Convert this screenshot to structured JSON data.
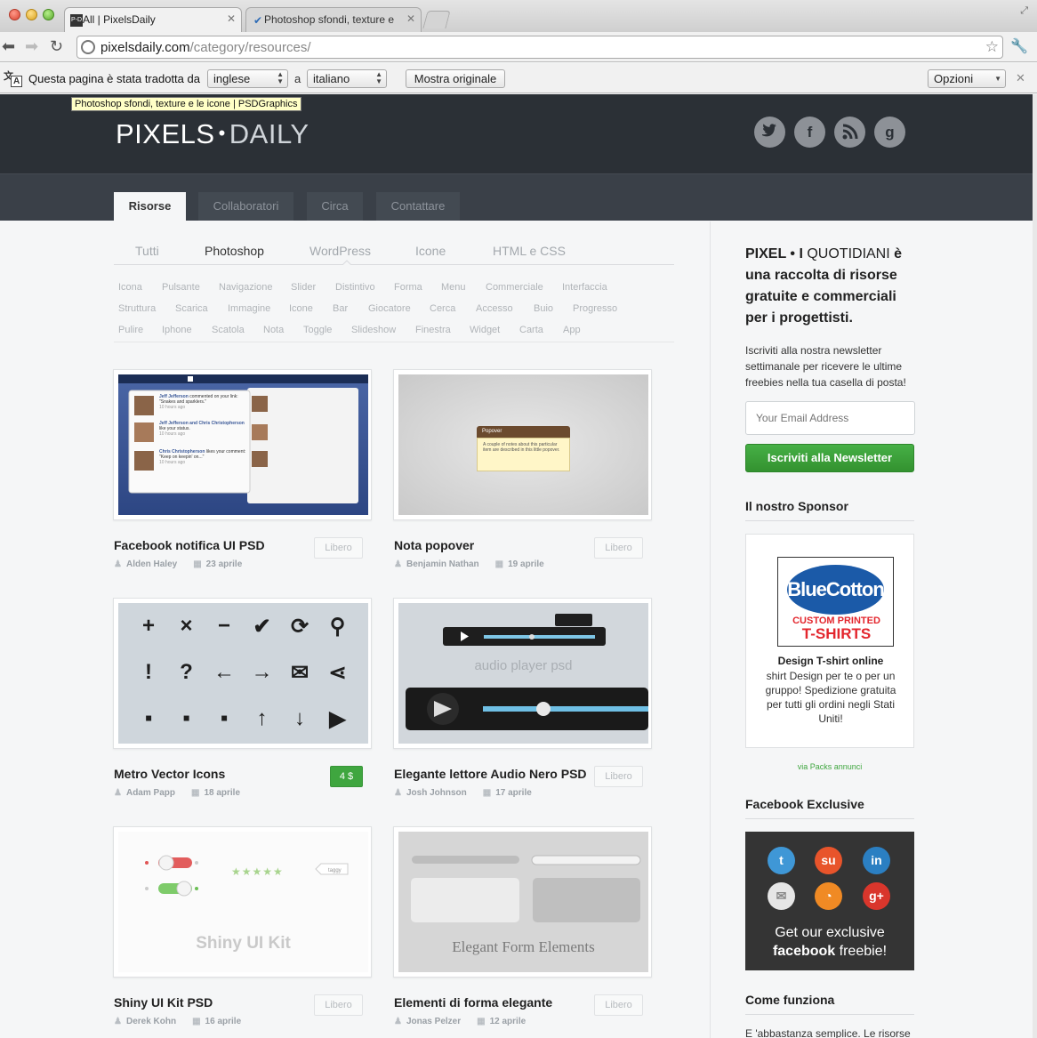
{
  "browser": {
    "tabs": [
      {
        "label": "All | PixelsDaily",
        "favicon": "P-D"
      },
      {
        "label": "Photoshop sfondi, texture e",
        "favicon": "✔"
      }
    ],
    "url_domain": "pixelsdaily.com",
    "url_path": "/category/resources/",
    "translate_bar": {
      "message": "Questa pagina è stata tradotta da",
      "from": "inglese",
      "to_word": "a",
      "to": "italiano",
      "show_original": "Mostra originale",
      "options": "Opzioni"
    },
    "tooltip": "Photoshop sfondi, texture e le icone | PSDGraphics"
  },
  "site": {
    "logo_pixels": "PIXELS",
    "logo_dot": "•",
    "logo_daily": "DAILY",
    "nav": [
      "Risorse",
      "Collaboratori",
      "Circa",
      "Contattare"
    ],
    "filters": [
      "Tutti",
      "Photoshop",
      "WordPress",
      "Icone",
      "HTML e CSS"
    ],
    "tags": [
      [
        "Icona",
        "Pulsante",
        "Navigazione",
        "Slider",
        "Distintivo",
        "Forma",
        "Menu",
        "Commerciale",
        "Interfaccia"
      ],
      [
        "Struttura",
        "Scarica",
        "Immagine",
        "Icone",
        "Bar",
        "Giocatore",
        "Cerca",
        "Accesso",
        "Buio",
        "Progresso"
      ],
      [
        "Pulire",
        "Iphone",
        "Scatola",
        "Nota",
        "Toggle",
        "Slideshow",
        "Finestra",
        "Widget",
        "Carta",
        "App"
      ]
    ]
  },
  "cards": [
    {
      "title": "Facebook notifica UI PSD",
      "author": "Alden Haley",
      "date": "23 aprile",
      "price": "Libero"
    },
    {
      "title": "Nota popover",
      "author": "Benjamin Nathan",
      "date": "19 aprile",
      "price": "Libero"
    },
    {
      "title": "Metro Vector Icons",
      "author": "Adam Papp",
      "date": "18 aprile",
      "price": "4 $"
    },
    {
      "title": "Elegante lettore Audio Nero PSD",
      "author": "Josh Johnson",
      "date": "17 aprile",
      "price": "Libero"
    },
    {
      "title": "Shiny UI Kit PSD",
      "author": "Derek Kohn",
      "date": "16 aprile",
      "price": "Libero"
    },
    {
      "title": "Elementi di forma elegante",
      "author": "Jonas Pelzer",
      "date": "12 aprile",
      "price": "Libero"
    }
  ],
  "thumbs": {
    "fb_names": [
      "Jeff Jefferson",
      "Jeff Jefferson and Chris Christopherson",
      "Chris Christopherson"
    ],
    "fb_texts": [
      "commented on your link: \"Snakes and sparklers.\"",
      "like your status.",
      "likes your comment: \"Keep on keepin' on...\""
    ],
    "fb_time": "10 hours ago",
    "popover_title": "Popover",
    "popover_text": "A couple of notes about this particular item are described in this little popover.",
    "metro_glyphs": [
      "+",
      "×",
      "−",
      "✔",
      "⟳",
      "⚲",
      "!",
      "?",
      "←",
      "→",
      "✉",
      "⋖",
      "▪",
      "▪",
      "▪",
      "↑",
      "↓",
      "▶"
    ],
    "audio_label": "audio player psd",
    "shiny_label": "Shiny UI Kit",
    "shiny_tag": "taggy",
    "shiny_stars": "★★★★★",
    "form_label": "Elegant Form Elements"
  },
  "sidebar": {
    "intro_brand": "PIXEL • I",
    "intro_light": "QUOTIDIANI",
    "intro_rest": "è una raccolta di risorse gratuite e commerciali per i progettisti.",
    "newsletter_desc": "Iscriviti alla nostra newsletter settimanale per ricevere le ultime freebies nella tua casella di posta!",
    "email_placeholder": "Your Email Address",
    "subscribe": "Iscriviti alla Newsletter",
    "sponsor_head": "Il nostro Sponsor",
    "bc_logo": "BlueCotton",
    "bc_line1": "CUSTOM PRINTED",
    "bc_line2": "T-SHIRTS",
    "sponsor_title": "Design T-shirt online",
    "sponsor_desc": "shirt Design per te o per un gruppo! Spedizione gratuita per tutti gli ordini negli Stati Uniti!",
    "via": "via Packs annunci",
    "fb_head": "Facebook Exclusive",
    "fb_cta1": "Get our exclusive",
    "fb_cta2_bold": "facebook",
    "fb_cta2_rest": "freebie!",
    "how_head": "Come funziona",
    "how_text": "E 'abbastanza semplice. Le risorse"
  }
}
